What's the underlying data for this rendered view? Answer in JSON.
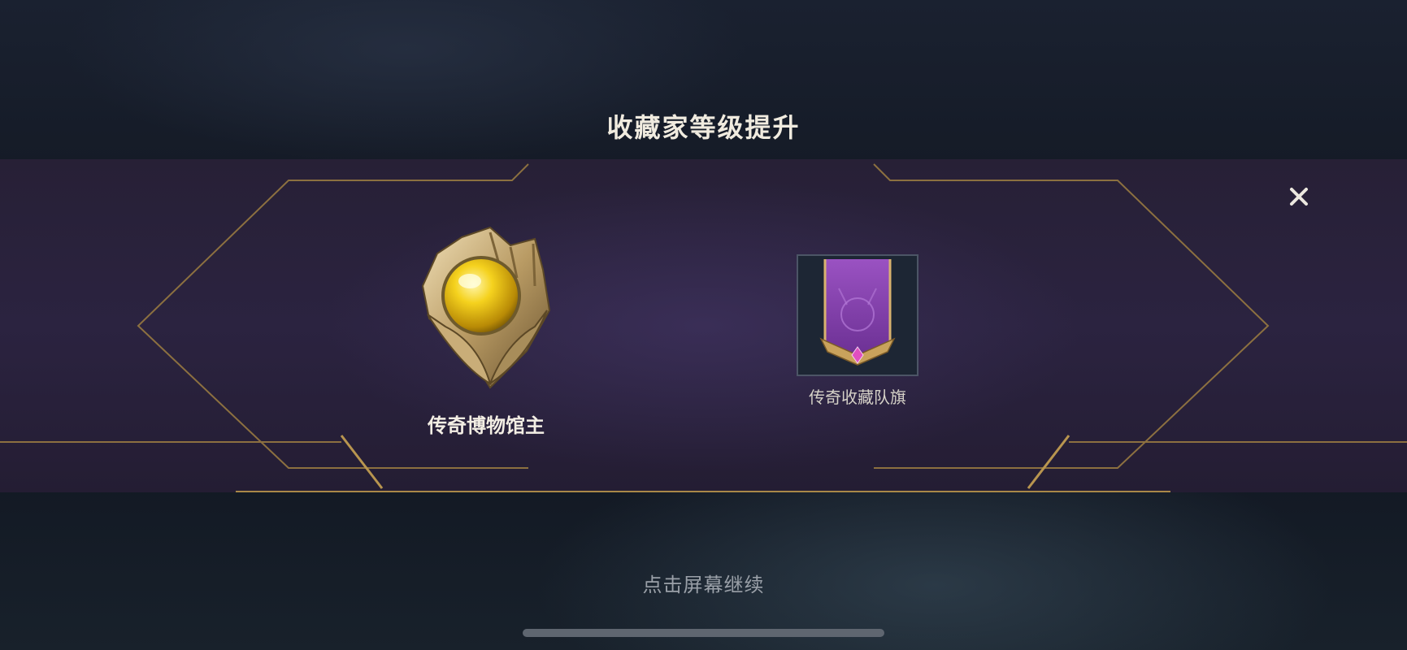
{
  "dialog": {
    "title": "收藏家等级提升",
    "close_icon": "close-icon",
    "accent_color": "#c8a464"
  },
  "rewards": [
    {
      "name": "传奇博物馆主",
      "icon": "golden-orb-emblem-icon"
    },
    {
      "name": "传奇收藏队旗",
      "icon": "purple-banner-icon"
    }
  ],
  "footer": {
    "continue_text": "点击屏幕继续"
  }
}
